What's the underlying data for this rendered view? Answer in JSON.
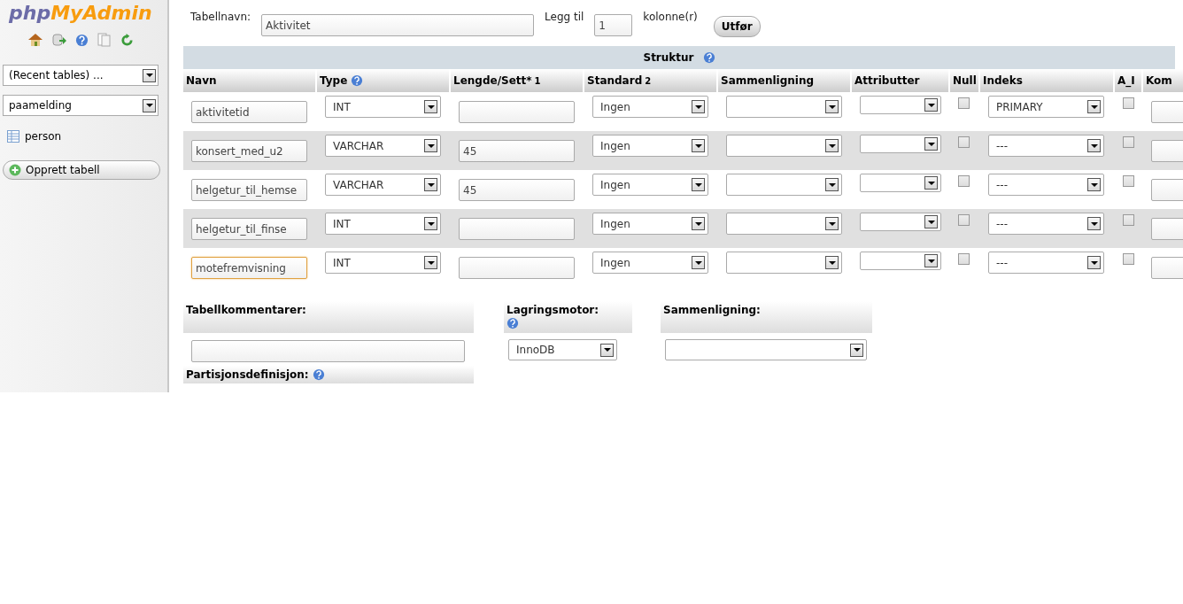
{
  "logo": {
    "part_1": "php",
    "part_2": "MyAdmin"
  },
  "sidebar": {
    "recent_tables": "(Recent tables) ...",
    "database": "paamelding",
    "tables": [
      "person"
    ],
    "create_button": "Opprett tabell"
  },
  "form": {
    "table_name_label": "Tabellnavn:",
    "table_name": "Aktivitet",
    "add_label": "Legg til",
    "add_count": "1",
    "add_unit": "kolonne(r)",
    "go_button": "Utfør"
  },
  "structure": {
    "title": "Struktur",
    "columns": [
      {
        "label": "Navn"
      },
      {
        "label": "Type",
        "help": true
      },
      {
        "label": "Lengde/Sett*",
        "note": "1"
      },
      {
        "label": "Standard",
        "note": "2"
      },
      {
        "label": "Sammenligning"
      },
      {
        "label": "Attributter"
      },
      {
        "label": "Null"
      },
      {
        "label": "Indeks"
      },
      {
        "label": "A_I"
      },
      {
        "label": "Kom"
      }
    ],
    "rows": [
      {
        "name": "aktivitetid",
        "name_focused": false,
        "type": "INT",
        "default": "Ingen",
        "null": false,
        "index": "PRIMARY",
        "ai": false
      },
      {
        "name": "konsert_med_u2",
        "name_focused": false,
        "type": "VARCHAR",
        "length": "45",
        "default": "Ingen",
        "null": false,
        "index": "---",
        "ai": false
      },
      {
        "name": "helgetur_til_hemse",
        "name_focused": false,
        "type": "VARCHAR",
        "length": "45",
        "default": "Ingen",
        "null": false,
        "index": "---",
        "ai": false
      },
      {
        "name": "helgetur_til_finse",
        "name_focused": false,
        "type": "INT",
        "default": "Ingen",
        "null": false,
        "index": "---",
        "ai": false
      },
      {
        "name": "motefremvisning",
        "name_focused": true,
        "type": "INT",
        "default": "Ingen",
        "null": false,
        "index": "---",
        "ai": false
      }
    ]
  },
  "bottom": {
    "comments_label": "Tabellkommentarer:",
    "engine_label": "Lagringsmotor:",
    "engine": "InnoDB",
    "collation_label": "Sammenligning:",
    "partition_label": "Partisjonsdefinisjon:"
  }
}
